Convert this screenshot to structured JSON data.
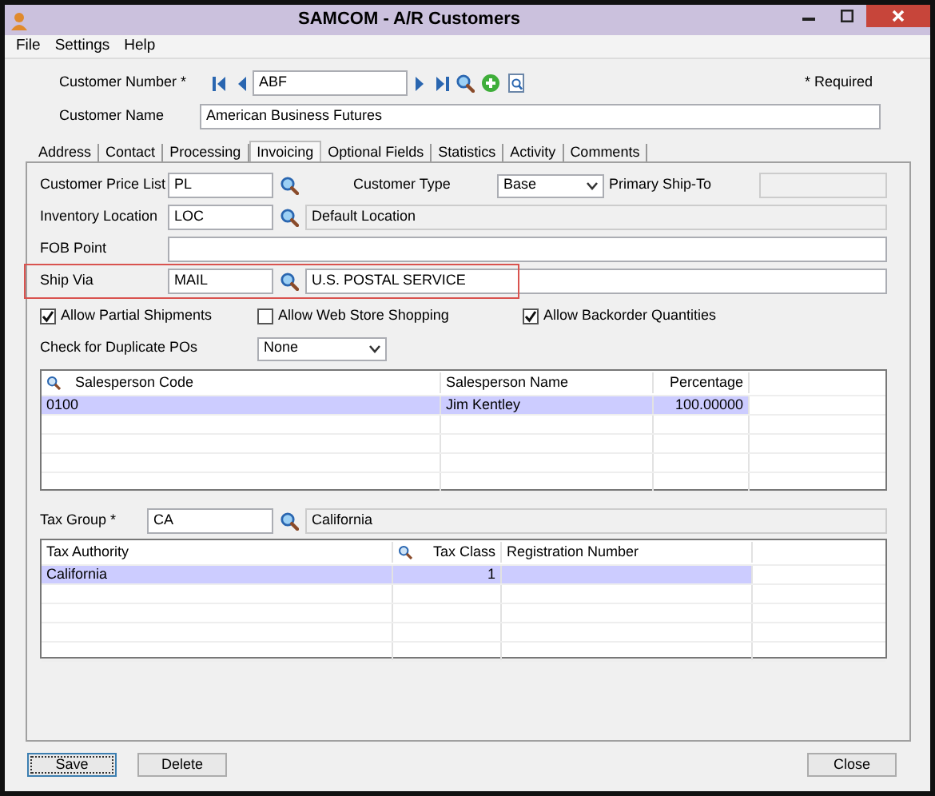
{
  "window": {
    "title": "SAMCOM - A/R Customers"
  },
  "menu": [
    {
      "label": "File"
    },
    {
      "label": "Settings"
    },
    {
      "label": "Help"
    }
  ],
  "header": {
    "customer_number": {
      "label": "Customer Number *",
      "value": "ABF"
    },
    "required_note": "* Required",
    "customer_name": {
      "label": "Customer Name",
      "value": "American Business Futures"
    }
  },
  "tabs": [
    {
      "label": "Address",
      "selected": false
    },
    {
      "label": "Contact",
      "selected": false
    },
    {
      "label": "Processing",
      "selected": false
    },
    {
      "label": "Invoicing",
      "selected": true
    },
    {
      "label": "Optional Fields",
      "selected": false
    },
    {
      "label": "Statistics",
      "selected": false
    },
    {
      "label": "Activity",
      "selected": false
    },
    {
      "label": "Comments",
      "selected": false
    }
  ],
  "invoicing": {
    "customer_price_list": {
      "label": "Customer Price List",
      "value": "PL"
    },
    "customer_type": {
      "label": "Customer Type",
      "value": "Base"
    },
    "primary_ship_to": {
      "label": "Primary Ship-To",
      "disabled": true
    },
    "inventory_location": {
      "label": "Inventory Location",
      "value": "LOC",
      "description": "Default Location",
      "disabled": true
    },
    "fob_point": {
      "label": "FOB Point"
    },
    "ship_via": {
      "label": "Ship Via",
      "value": "MAIL",
      "description": "U.S. POSTAL SERVICE",
      "disabled": false,
      "highlighted": true
    },
    "options": [
      {
        "label": "Allow Partial Shipments",
        "checked": true
      },
      {
        "label": "Allow Web Store Shopping",
        "checked": false
      },
      {
        "label": "Allow Backorder Quantities",
        "checked": true
      }
    ],
    "duplicate_pos": {
      "label": "Check for Duplicate POs",
      "value": "None"
    }
  },
  "salesperson_table": {
    "columns": [
      "Salesperson Code",
      "Salesperson Name",
      "Percentage"
    ],
    "rows": [
      {
        "cells": [
          "0100",
          "Jim Kentley",
          "100.00000"
        ],
        "selected": true
      }
    ]
  },
  "tax_group": {
    "label": "Tax Group *",
    "value": "CA",
    "description": "California",
    "disabled": true
  },
  "tax_table": {
    "columns": [
      "Tax Authority",
      "Tax Class",
      "Registration Number"
    ],
    "rows": [
      {
        "cells": [
          "California",
          "1",
          ""
        ],
        "selected": true
      }
    ]
  },
  "buttons": [
    {
      "label": "Save",
      "focused": true
    },
    {
      "label": "Delete",
      "focused": false
    },
    {
      "label": "Close",
      "focused": false
    }
  ]
}
